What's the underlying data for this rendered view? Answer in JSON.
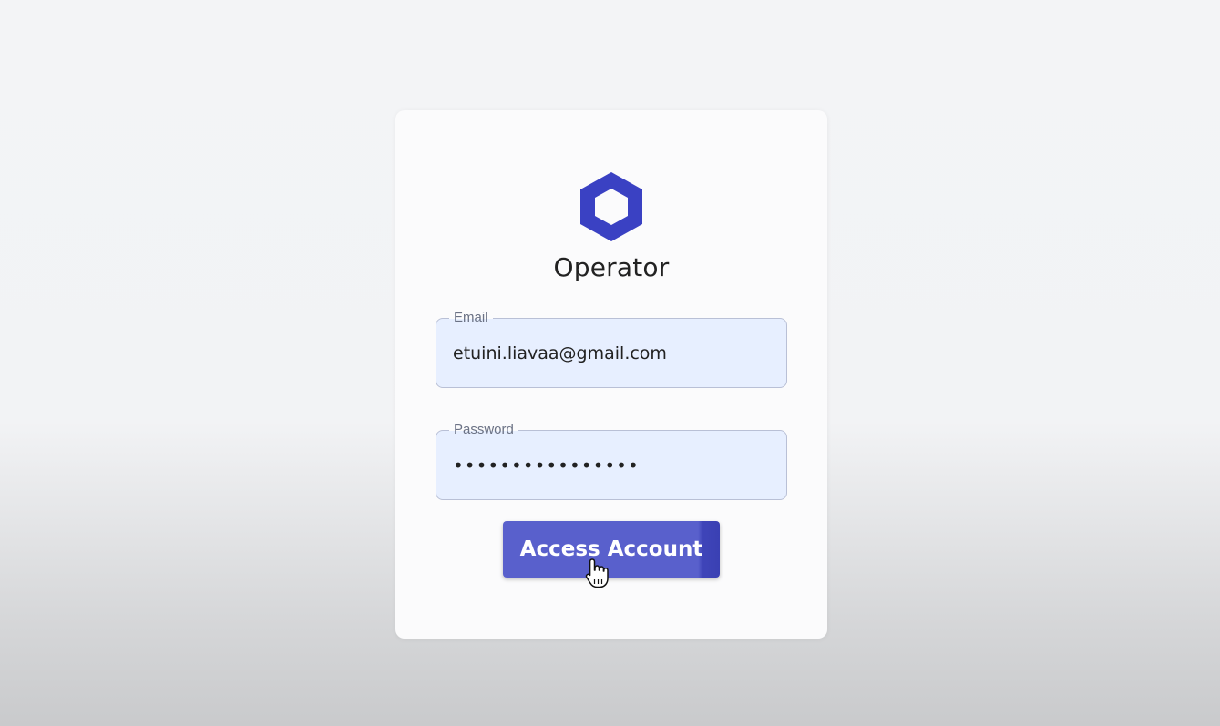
{
  "brand": {
    "name": "Operator",
    "logo_icon": "hexagon-logo-icon",
    "logo_color": "#3a41c3"
  },
  "form": {
    "email": {
      "label": "Email",
      "value": "etuini.liavaa@gmail.com"
    },
    "password": {
      "label": "Password",
      "value": "••••••••••••••••"
    },
    "submit_label": "Access Account"
  },
  "colors": {
    "button": "#5960cc",
    "field_background": "#e7efff"
  },
  "cursor_icon": "hand-pointer-icon"
}
